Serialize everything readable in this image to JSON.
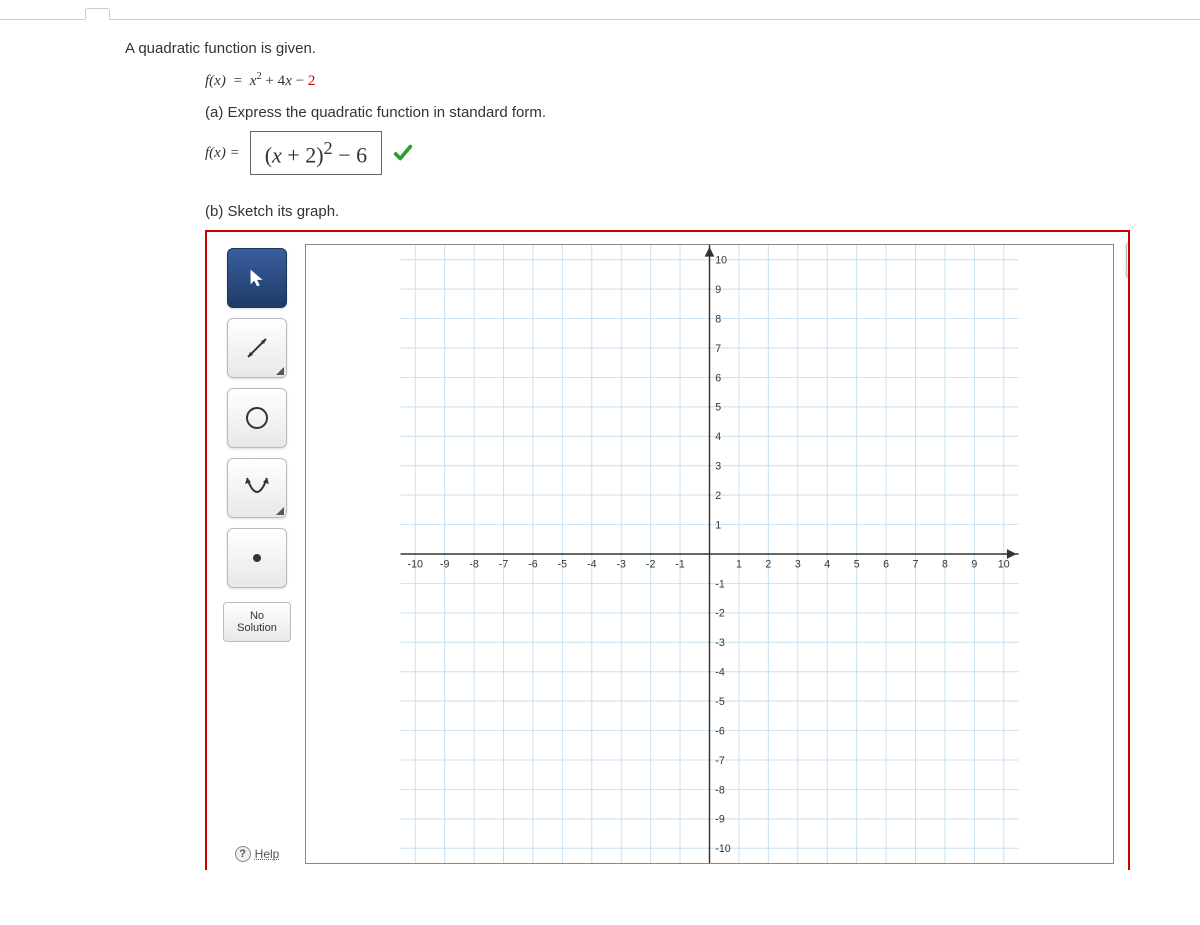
{
  "question": {
    "intro": "A quadratic function is given.",
    "func_lhs": "f(x)",
    "func_eq": "=",
    "func_x2": "x",
    "func_plus": " + 4",
    "func_xvar": "x",
    "func_minus": " − ",
    "func_const": "2",
    "partA": "(a) Express the quadratic function in standard form.",
    "answer_row_lhs": "f(x) =",
    "answer_value_pre": "(",
    "answer_value_x": "x",
    "answer_value_plus": " + 2)",
    "answer_value_exp": "2",
    "answer_value_tail": " − 6",
    "partB": "(b) Sketch its graph."
  },
  "toolbar": {
    "tools": [
      "pointer",
      "line",
      "circle",
      "parabola",
      "point"
    ],
    "nosol_line1": "No",
    "nosol_line2": "Solution",
    "help": "Help"
  },
  "expand": "»",
  "chart_data": {
    "type": "cartesian-grid",
    "xmin": -10.5,
    "xmax": 10.5,
    "ymin": -10.5,
    "ymax": 10.5,
    "x_ticks": [
      -10,
      -9,
      -8,
      -7,
      -6,
      -5,
      -4,
      -3,
      -2,
      -1,
      1,
      2,
      3,
      4,
      5,
      6,
      7,
      8,
      9,
      10
    ],
    "y_ticks": [
      10,
      9,
      8,
      7,
      6,
      5,
      4,
      3,
      2,
      1,
      -1,
      -2,
      -3,
      -4,
      -5,
      -6,
      -7,
      -8,
      -9,
      -10
    ],
    "plotted": []
  }
}
